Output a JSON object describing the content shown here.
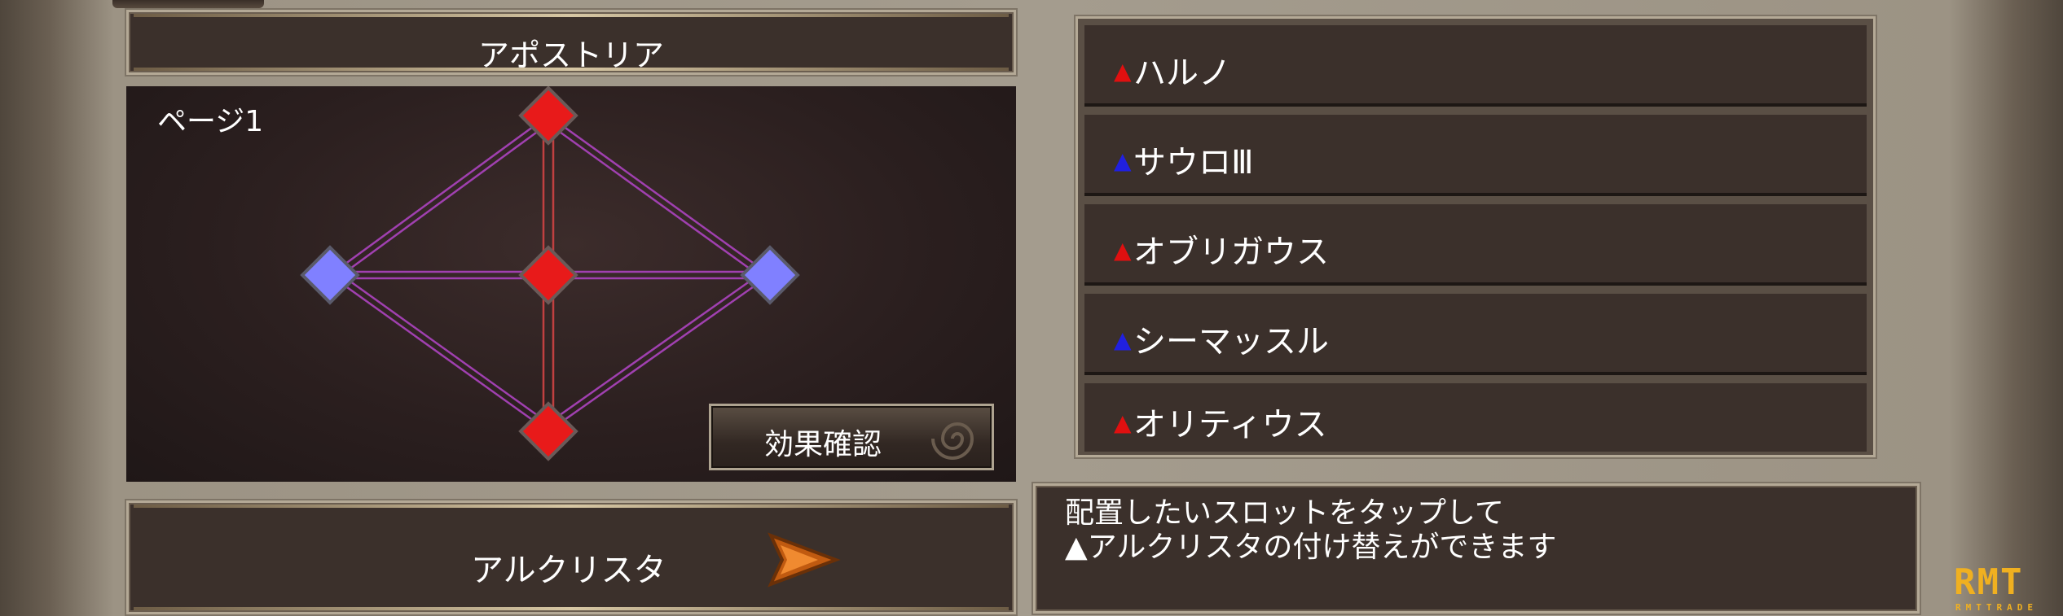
{
  "header": {
    "title": "アポストリア"
  },
  "canvas": {
    "page_label": "ページ1"
  },
  "effect_button": {
    "label": "効果確認",
    "icon": "swirl-icon"
  },
  "alcrysta": {
    "label": "アルクリスタ",
    "arrow_icon": "play-arrow-icon"
  },
  "slots": [
    {
      "marker": "▲",
      "marker_color": "#e01010",
      "name": "ハルノ"
    },
    {
      "marker": "▲",
      "marker_color": "#2020e0",
      "name": "サウロⅢ"
    },
    {
      "marker": "▲",
      "marker_color": "#e01010",
      "name": "オブリガウス"
    },
    {
      "marker": "▲",
      "marker_color": "#2020e0",
      "name": "シーマッスル"
    },
    {
      "marker": "▲",
      "marker_color": "#e01010",
      "name": "オリティウス"
    }
  ],
  "info": {
    "line1": "配置したいスロットをタップして",
    "line2": "▲アルクリスタの付け替えができます"
  },
  "watermark": {
    "big": "RMT",
    "small": "RMTTRADE"
  },
  "colors": {
    "red_node": "#e81a1a",
    "blue_node": "#8080ff",
    "link_line": "#a040b0",
    "panel": "#3b302b",
    "border": "#b4a996"
  }
}
